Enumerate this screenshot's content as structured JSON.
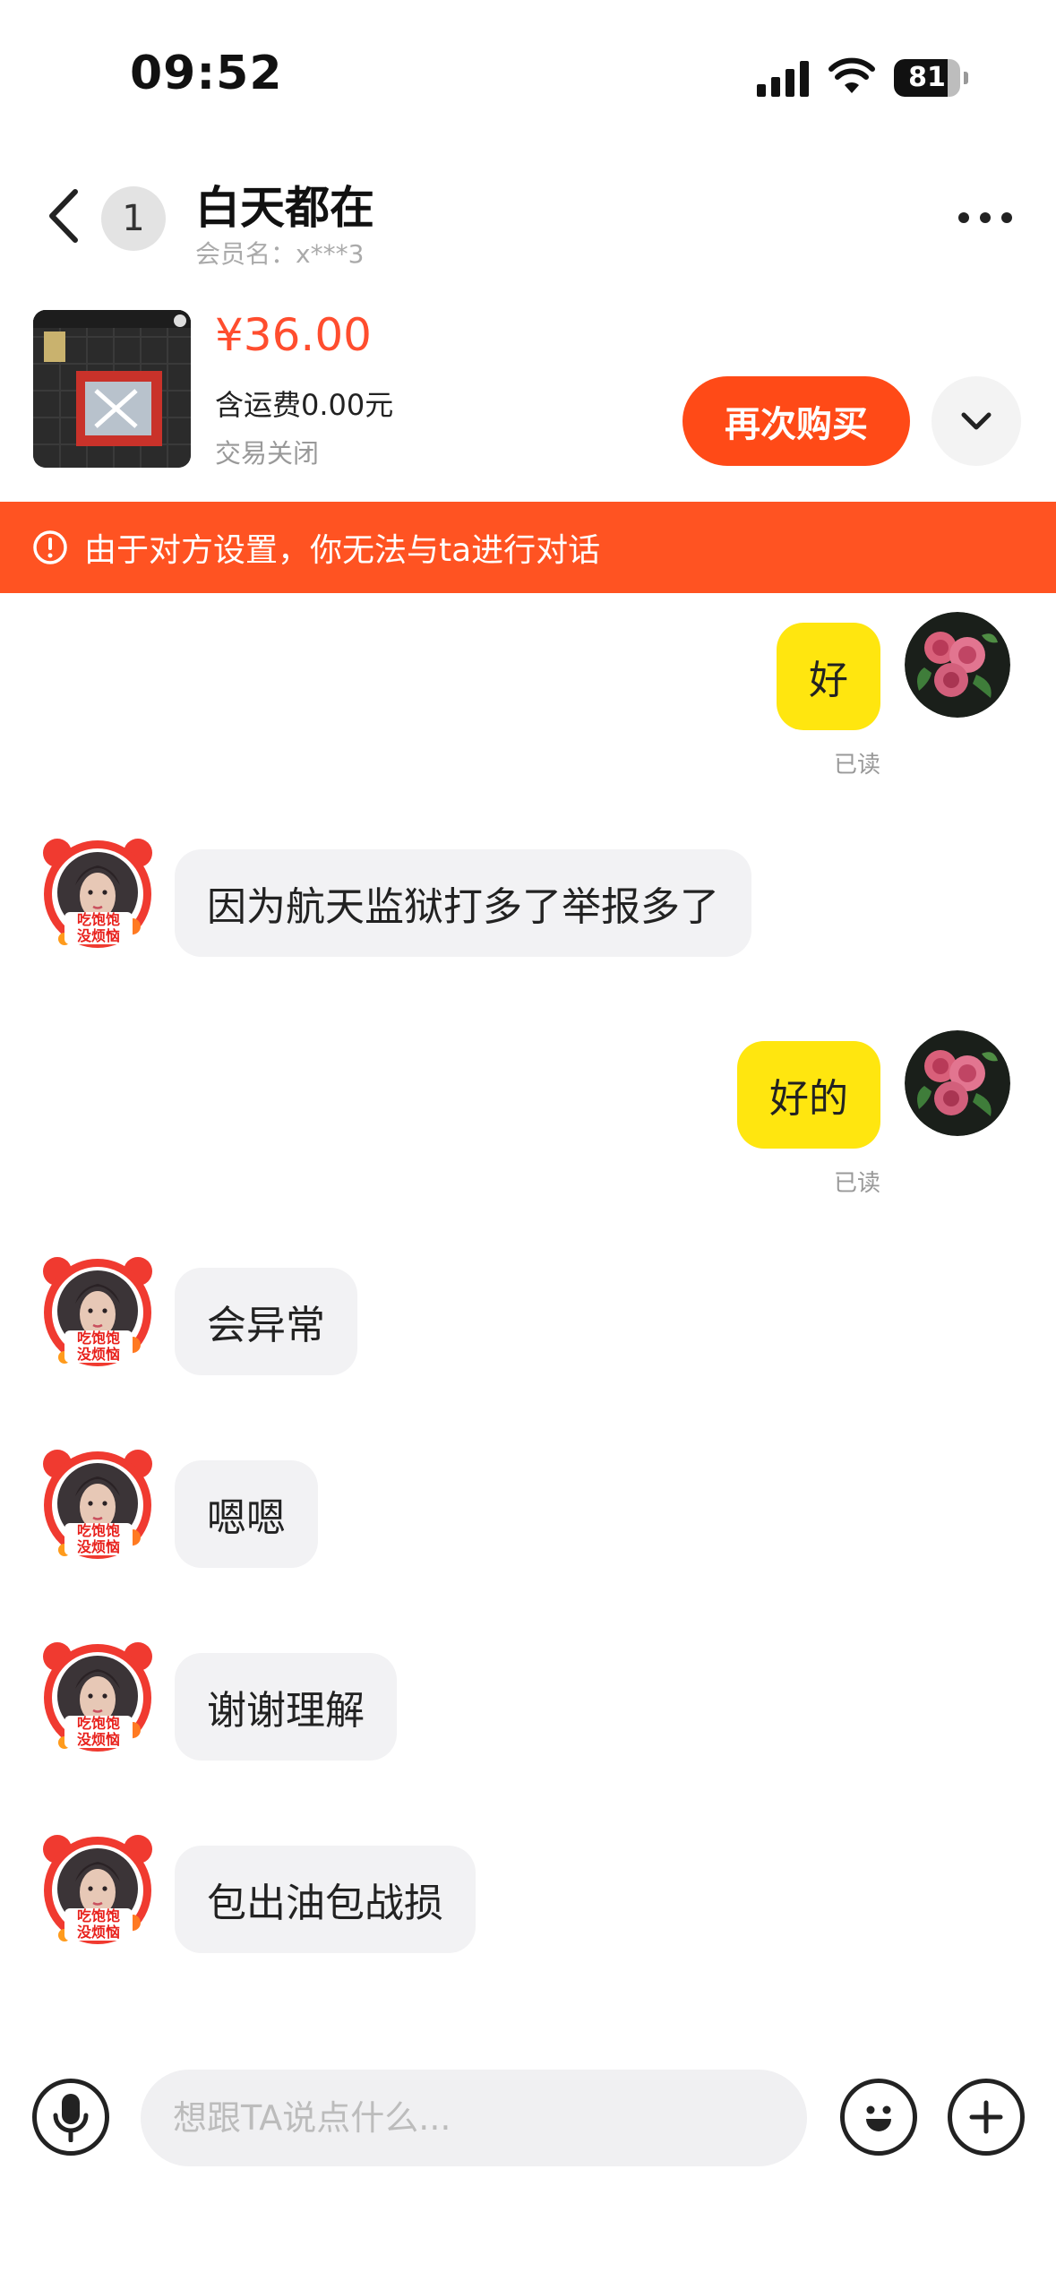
{
  "status_bar": {
    "time": "09:52",
    "battery": "81"
  },
  "header": {
    "unread_count": "1",
    "contact_name": "白天都在",
    "member_name": "会员名：x***3"
  },
  "product": {
    "price": "¥36.00",
    "shipping": "含运费0.00元",
    "status": "交易关闭",
    "buy_again_label": "再次购买"
  },
  "banner": {
    "text": "由于对方设置，你无法与ta进行对话"
  },
  "messages": [
    {
      "sender": "me",
      "text": "好",
      "read": "已读"
    },
    {
      "sender": "them",
      "text": "因为航天监狱打多了举报多了"
    },
    {
      "sender": "me",
      "text": "好的",
      "read": "已读"
    },
    {
      "sender": "them",
      "text": "会异常"
    },
    {
      "sender": "them",
      "text": "嗯嗯"
    },
    {
      "sender": "them",
      "text": "谢谢理解"
    },
    {
      "sender": "them",
      "text": "包出油包战损"
    }
  ],
  "avatar_badge": [
    "吃饱饱",
    "没烦恼"
  ],
  "input": {
    "placeholder": "想跟TA说点什么..."
  },
  "colors": {
    "accent": "#ff4a17",
    "banner": "#ff5322",
    "my_bubble": "#ffe60f",
    "their_bubble": "#f2f2f4",
    "price": "#ff4d2e"
  }
}
